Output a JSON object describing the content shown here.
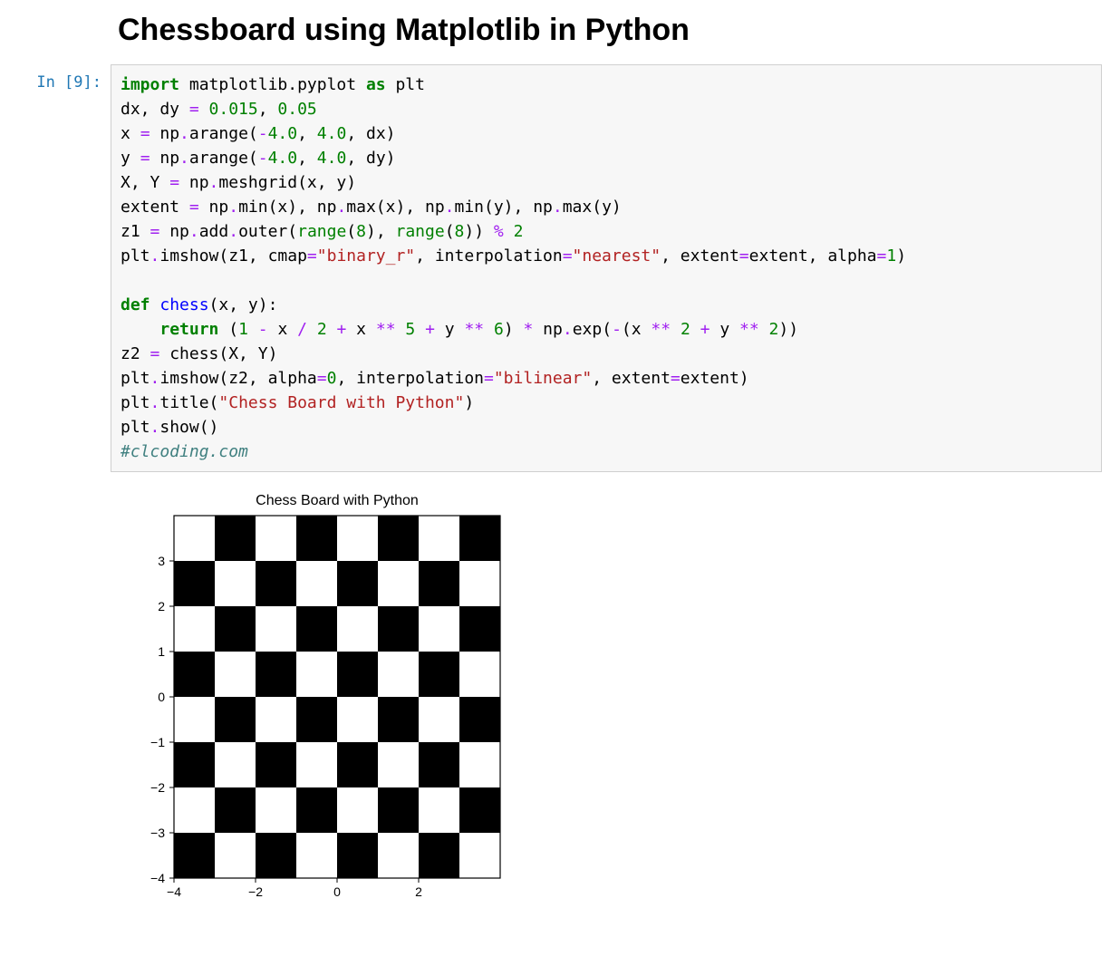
{
  "title": "Chessboard using Matplotlib in Python",
  "prompt": "In [9]:",
  "code": {
    "l1_import": "import",
    "l1_mpl": " matplotlib.pyplot ",
    "l1_as": "as",
    "l1_plt": " plt",
    "l2a": "dx, dy ",
    "l2eq": "=",
    "l2sp": " ",
    "l2n1": "0.015",
    "l2c": ", ",
    "l2n2": "0.05",
    "l3a": "x ",
    "l3eq": "=",
    "l3b": " np",
    "l3dot": ".",
    "l3ar": "arange(",
    "l3n1": "-",
    "l3n1b": "4.0",
    "l3c1": ", ",
    "l3n2": "4.0",
    "l3c2": ", dx)",
    "l4a": "y ",
    "l4eq": "=",
    "l4b": " np",
    "l4dot": ".",
    "l4ar": "arange(",
    "l4n1": "-",
    "l4n1b": "4.0",
    "l4c1": ", ",
    "l4n2": "4.0",
    "l4c2": ", dy)",
    "l5a": "X, Y ",
    "l5eq": "=",
    "l5b": " np",
    "l5dot": ".",
    "l5mg": "meshgrid(x, y)",
    "l6a": "extent ",
    "l6eq": "=",
    "l6b": " np",
    "l6dot1": ".",
    "l6min": "min(x), np",
    "l6dot2": ".",
    "l6max": "max(x), np",
    "l6dot3": ".",
    "l6miny": "min(y), np",
    "l6dot4": ".",
    "l6maxy": "max(y)",
    "l7a": "z1 ",
    "l7eq": "=",
    "l7b": " np",
    "l7dot": ".",
    "l7add": "add",
    "l7dot2": ".",
    "l7out": "outer(",
    "l7range1": "range",
    "l7r1p": "(",
    "l7n8a": "8",
    "l7r1c": "), ",
    "l7range2": "range",
    "l7r2p": "(",
    "l7n8b": "8",
    "l7r2c": ")) ",
    "l7mod": "%",
    "l7sp": " ",
    "l7n2": "2",
    "l8a": "plt",
    "l8dot": ".",
    "l8im": "imshow(z1, cmap",
    "l8eq1": "=",
    "l8s1": "\"binary_r\"",
    "l8c1": ", interpolation",
    "l8eq2": "=",
    "l8s2": "\"nearest\"",
    "l8c2": ", extent",
    "l8eq3": "=",
    "l8ext": "extent, alpha",
    "l8eq4": "=",
    "l8n1": "1",
    "l8end": ")",
    "l10def": "def",
    "l10name": " chess",
    "l10args": "(x, y):",
    "l11ret": "return",
    "l11sp": " (",
    "l11n1": "1",
    "l11m1": " ",
    "l11op1": "-",
    "l11m2": " x ",
    "l11op2": "/",
    "l11m3": " ",
    "l11n2": "2",
    "l11m4": " ",
    "l11op3": "+",
    "l11m5": " x ",
    "l11op4": "**",
    "l11m6": " ",
    "l11n5": "5",
    "l11m7": " ",
    "l11op5": "+",
    "l11m8": " y ",
    "l11op6": "**",
    "l11m9": " ",
    "l11n6": "6",
    "l11m10": ") ",
    "l11op7": "*",
    "l11m11": " np",
    "l11dot": ".",
    "l11exp": "exp(",
    "l11op8": "-",
    "l11m12": "(x ",
    "l11op9": "**",
    "l11m13": " ",
    "l11n2b": "2",
    "l11m14": " ",
    "l11op10": "+",
    "l11m15": " y ",
    "l11op11": "**",
    "l11m16": " ",
    "l11n2c": "2",
    "l11end": "))",
    "l12a": "z2 ",
    "l12eq": "=",
    "l12b": " chess(X, Y)",
    "l13a": "plt",
    "l13dot": ".",
    "l13im": "imshow(z2, alpha",
    "l13eq1": "=",
    "l13n0": "0",
    "l13c1": ", interpolation",
    "l13eq2": "=",
    "l13s1": "\"bilinear\"",
    "l13c2": ", extent",
    "l13eq3": "=",
    "l13ext": "extent)",
    "l14a": "plt",
    "l14dot": ".",
    "l14ti": "title(",
    "l14s": "\"Chess Board with Python\"",
    "l14end": ")",
    "l15a": "plt",
    "l15dot": ".",
    "l15sh": "show()",
    "l16": "#clcoding.com"
  },
  "chart_data": {
    "type": "heatmap",
    "title": "Chess Board with Python",
    "x_ticks": [
      -4,
      -2,
      0,
      2
    ],
    "y_ticks": [
      -4,
      -3,
      -2,
      -1,
      0,
      1,
      2,
      3
    ],
    "xlim": [
      -4,
      4
    ],
    "ylim": [
      -4,
      4
    ],
    "grid_size": 8,
    "pattern": "checkerboard",
    "colors": [
      "#000000",
      "#ffffff"
    ]
  }
}
